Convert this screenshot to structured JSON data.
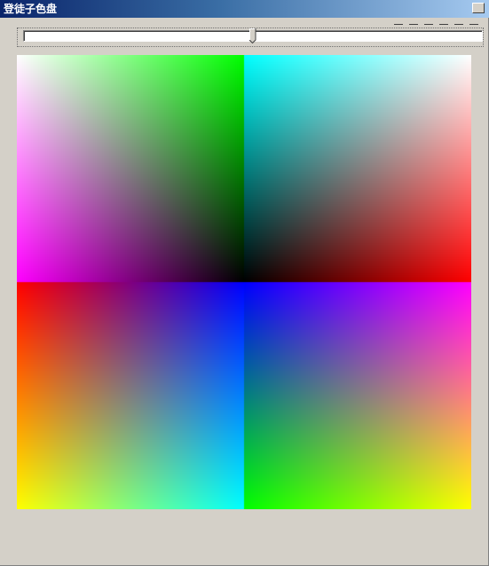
{
  "window": {
    "title": "登徒子色盘"
  },
  "slider": {
    "value_fraction": 0.5
  },
  "palette": {
    "quadrants": [
      {
        "position": "top-left",
        "corners": {
          "top-left": "#ffffff",
          "top-right": "#00ff00",
          "bottom-left": "#ff00ff",
          "bottom-right": "#000000"
        }
      },
      {
        "position": "top-right",
        "corners": {
          "top-left": "#00ffff",
          "top-right": "#ffffff",
          "bottom-left": "#000000",
          "bottom-right": "#ff0000"
        }
      },
      {
        "position": "bottom-left",
        "corners": {
          "top-left": "#ff0000",
          "top-right": "#0000ff",
          "bottom-left": "#ffff00",
          "bottom-right": "#00ffff"
        }
      },
      {
        "position": "bottom-right",
        "corners": {
          "top-left": "#0000ff",
          "top-right": "#ff00ff",
          "bottom-left": "#00ff00",
          "bottom-right": "#ffff00"
        }
      }
    ]
  }
}
